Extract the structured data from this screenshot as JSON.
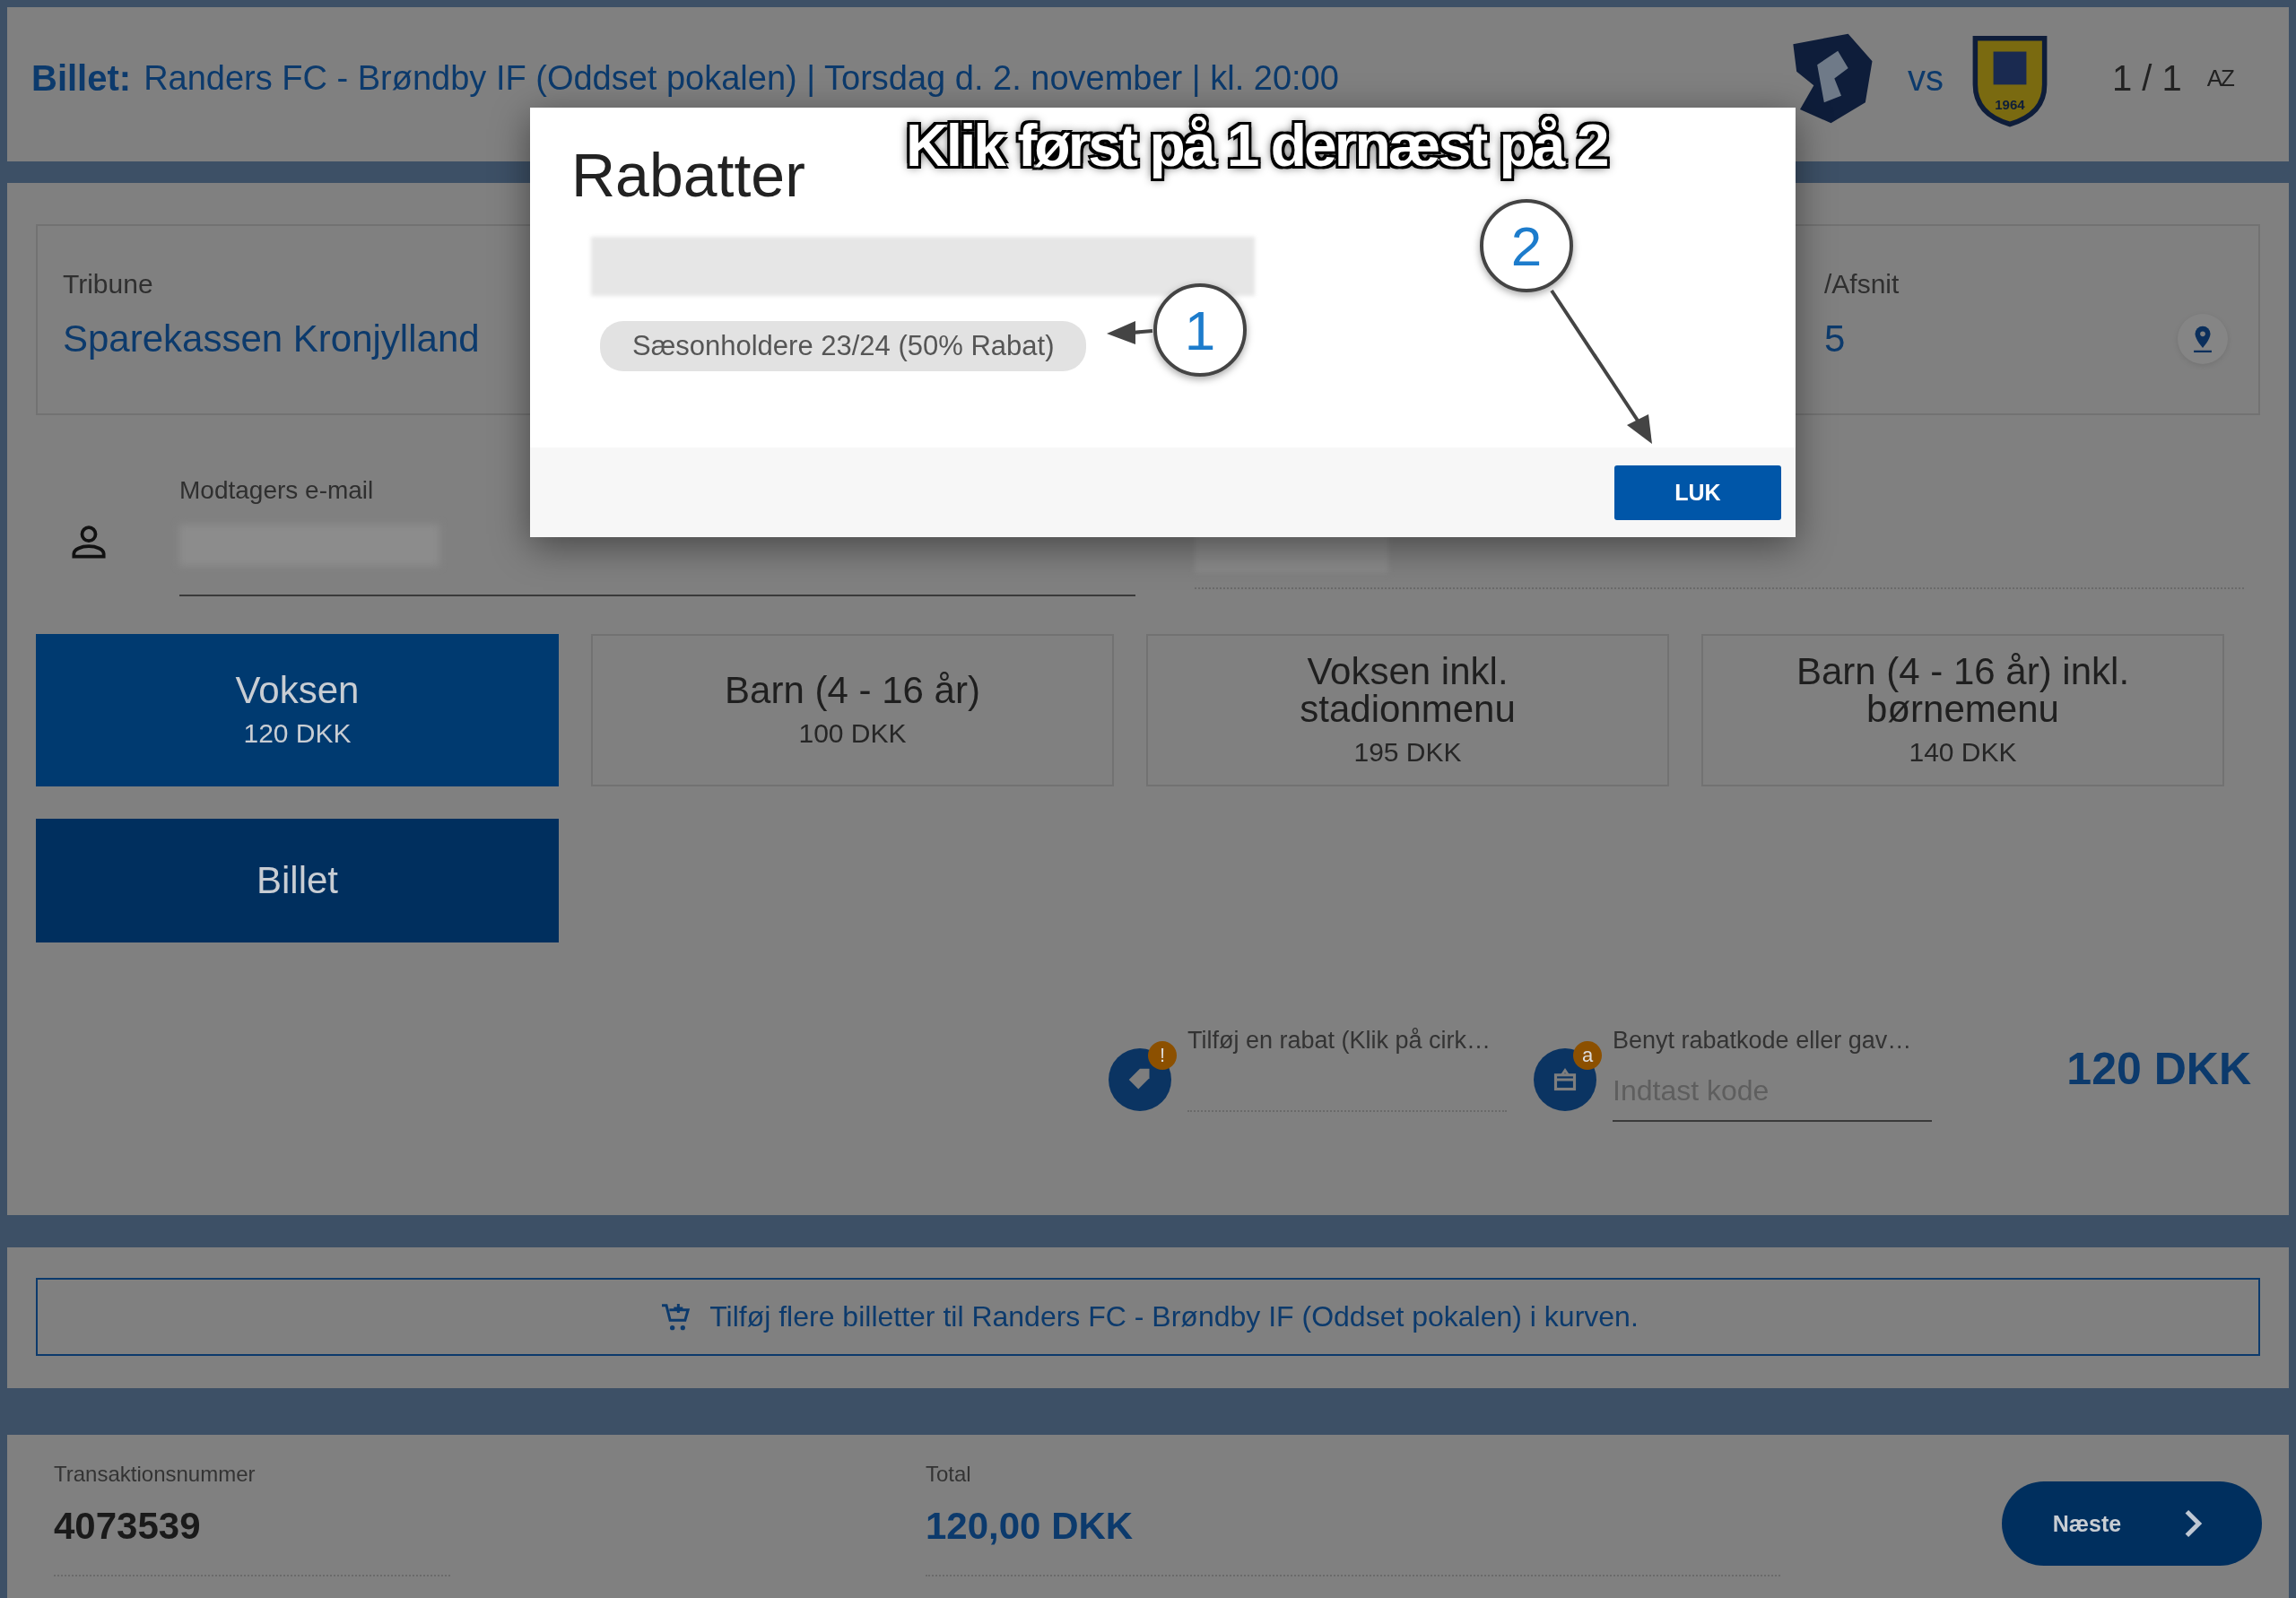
{
  "header": {
    "prefix": "Billet:",
    "title": "Randers FC - Brøndby IF (Oddset pokalen) | Torsdag d. 2. november | kl. 20:00",
    "vs": "vs",
    "away_logo_year": "1964",
    "pager": "1 / 1",
    "sort_label": "AZ"
  },
  "seat": {
    "fields": [
      {
        "label": "Tribune",
        "value": "Sparekassen Kronjylland"
      },
      {
        "label": "/Afsnit",
        "value": "5"
      }
    ]
  },
  "recipient": {
    "label": "Modtagers e-mail"
  },
  "ticket_types": [
    {
      "label": "Voksen",
      "price": "120 DKK",
      "selected": true
    },
    {
      "label": "Barn (4 - 16 år)",
      "price": "100 DKK",
      "selected": false
    },
    {
      "label": "Voksen inkl. stadionmenu",
      "price": "195 DKK",
      "selected": false
    },
    {
      "label": "Barn (4 - 16 år) inkl. børnemenu",
      "price": "140 DKK",
      "selected": false
    }
  ],
  "products": [
    {
      "label": "Billet",
      "selected": true
    }
  ],
  "discount": {
    "label": "Tilføj en rabat (Klik på cirk…",
    "badge": "!"
  },
  "code": {
    "label": "Benyt rabatkode eller gav…",
    "placeholder": "Indtast kode",
    "badge": "a"
  },
  "line_price": "120 DKK",
  "cart_link": "Tilføj flere billetter til Randers FC - Brøndby IF (Oddset pokalen) i kurven.",
  "summary": {
    "transaction_label": "Transaktionsnummer",
    "transaction_number": "4073539",
    "total_label": "Total",
    "total": "120,00 DKK",
    "next": "Næste"
  },
  "modal": {
    "title": "Rabatter",
    "discounts": [
      {
        "label": "Sæsonholdere 23/24 (50% Rabat)"
      }
    ],
    "close": "LUK"
  },
  "annotations": {
    "instruction": "Klik først på 1 dernæst på 2",
    "markers": [
      {
        "number": "1"
      },
      {
        "number": "2"
      }
    ]
  }
}
